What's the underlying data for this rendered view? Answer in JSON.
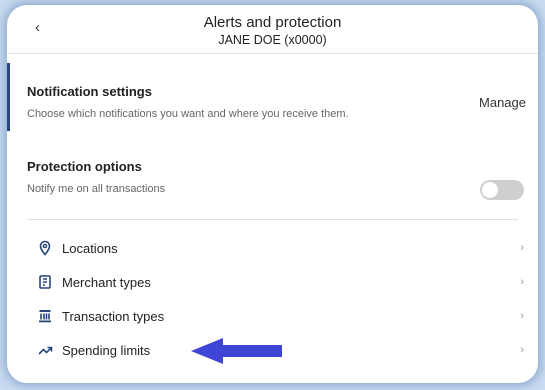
{
  "header": {
    "back_icon": "‹",
    "title": "Alerts and protection",
    "subtitle": "JANE DOE (x0000)"
  },
  "notification": {
    "title": "Notification settings",
    "description": "Choose which notifications you want and where you receive them.",
    "manage_label": "Manage"
  },
  "protection": {
    "title": "Protection options",
    "description": "Notify me on all transactions",
    "toggle_on": false
  },
  "list": {
    "items": [
      {
        "label": "Locations",
        "icon": "location-pin-icon"
      },
      {
        "label": "Merchant types",
        "icon": "merchant-icon"
      },
      {
        "label": "Transaction types",
        "icon": "bank-icon"
      },
      {
        "label": "Spending limits",
        "icon": "trending-up-icon"
      }
    ],
    "chevron": "›"
  },
  "colors": {
    "accent": "#27467a",
    "annotation_arrow": "#3f46d6",
    "icon": "#27467a"
  }
}
